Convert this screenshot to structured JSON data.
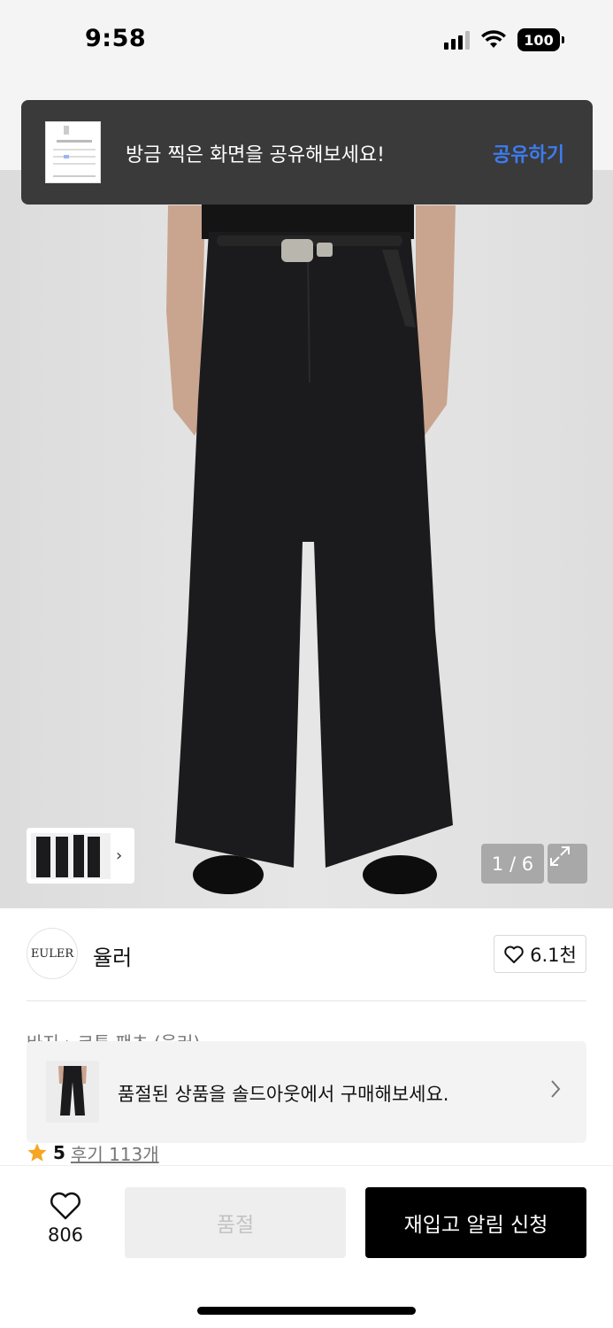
{
  "status_bar": {
    "time": "9:58",
    "battery": "100"
  },
  "toast": {
    "message": "방금 찍은 화면을 공유해보세요!",
    "action": "공유하기"
  },
  "product": {
    "image_counter": "1 / 6"
  },
  "brand": {
    "logo_text": "EULER",
    "name": "율러",
    "likes": "6.1천"
  },
  "breadcrumb": "바지 › 코튼 팬츠 (율러)",
  "soldout_banner": {
    "text": "품절된 상품을 솔드아웃에서 구매해보세요."
  },
  "reviews": {
    "score": "5",
    "link": "후기 113개"
  },
  "bottom_bar": {
    "wish_count": "806",
    "soldout_label": "품절",
    "restock_label": "재입고 알림 신청"
  },
  "colors": {
    "accent": "#3d7bf0",
    "star": "#f5a623",
    "primary_button": "#000000"
  }
}
